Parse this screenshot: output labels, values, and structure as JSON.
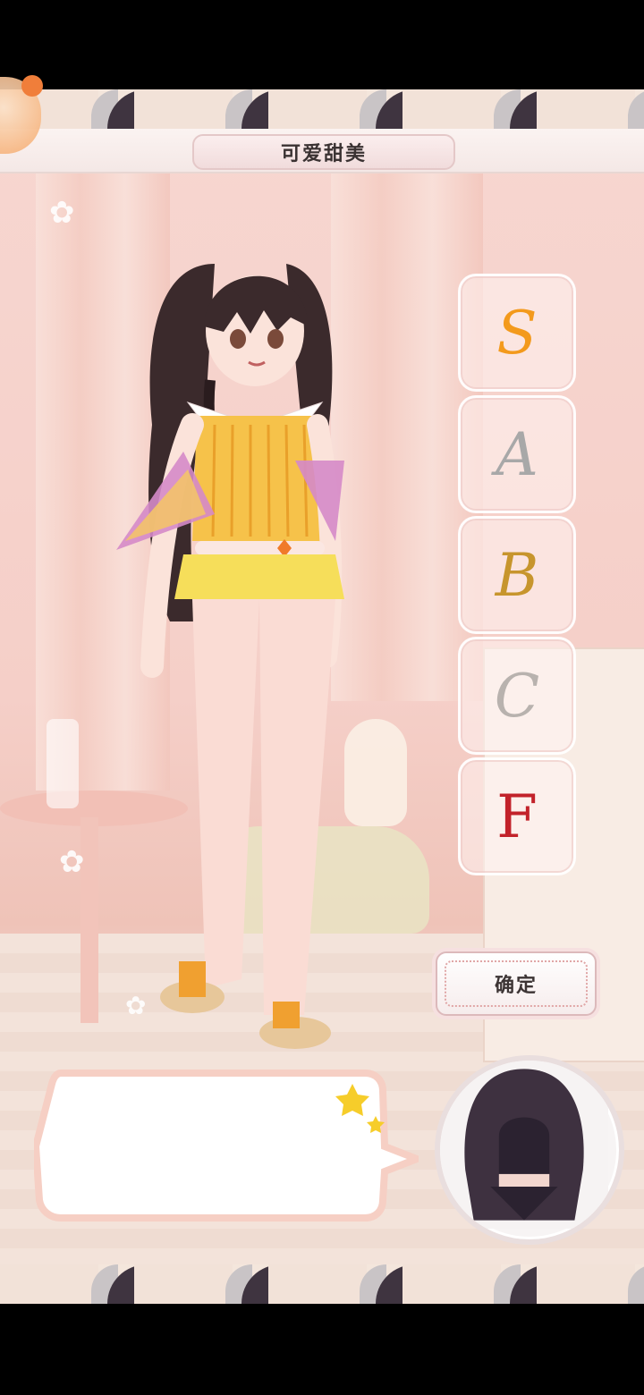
{
  "header": {
    "theme_title": "可爱甜美"
  },
  "grades": [
    {
      "letter": "S",
      "color": "#f39a1c"
    },
    {
      "letter": "A",
      "color": "#a8a8a8"
    },
    {
      "letter": "B",
      "color": "#c7952d"
    },
    {
      "letter": "C",
      "color": "#b8b2ae"
    },
    {
      "letter": "F",
      "color": "#c2222a"
    }
  ],
  "confirm_button": {
    "label": "确定"
  },
  "dialog": {
    "text": ""
  },
  "icons": {
    "stars": "star-icon",
    "avatar": "hooded-figure-avatar"
  }
}
